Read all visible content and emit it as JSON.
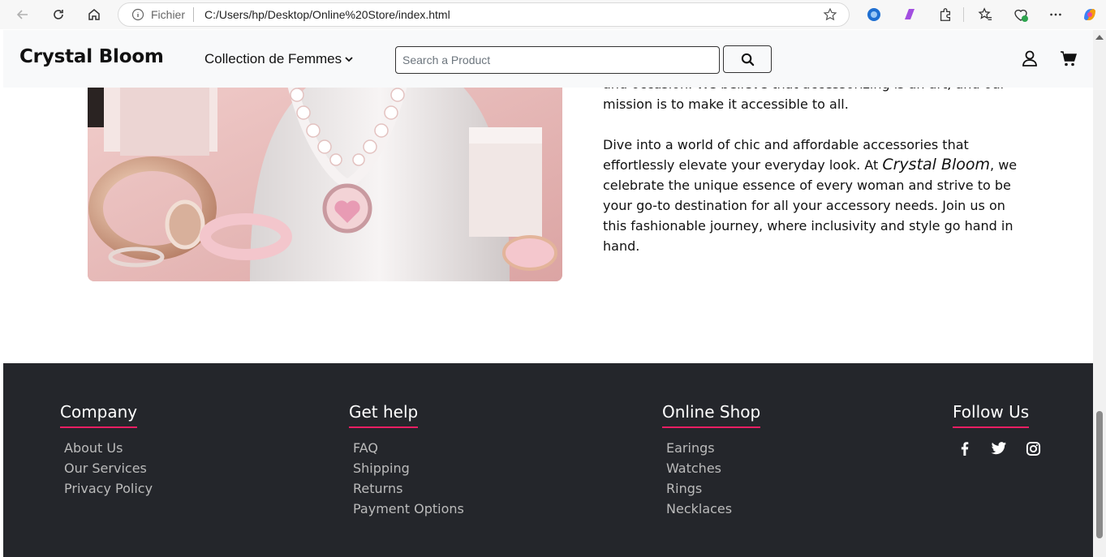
{
  "browser": {
    "scheme_label": "Fichier",
    "url": "C:/Users/hp/Desktop/Online%20Store/index.html"
  },
  "header": {
    "logo": "Crystal Bloom",
    "collection_label": "Collection de Femmes",
    "search_placeholder": "Search a Product"
  },
  "about": {
    "paragraph1_visible": "and occasion. We believe that accessorizing is an art, and our mission is to make it accessible to all.",
    "paragraph2_before": "Dive into a world of chic and affordable accessories that effortlessly elevate your everyday look. At ",
    "paragraph2_brand": "Crystal Bloom",
    "paragraph2_after": ", we celebrate the unique essence of every woman and strive to be your go-to destination for all your accessory needs. Join us on this fashionable journey, where inclusivity and style go hand in hand."
  },
  "footer": {
    "company": {
      "title": "Company",
      "links": [
        "About Us",
        "Our Services",
        "Privacy Policy"
      ]
    },
    "help": {
      "title": "Get help",
      "links": [
        "FAQ",
        "Shipping",
        "Returns",
        "Payment Options"
      ]
    },
    "shop": {
      "title": "Online Shop",
      "links": [
        "Earings",
        "Watches",
        "Rings",
        "Necklaces"
      ]
    },
    "follow": {
      "title": "Follow Us",
      "icons": [
        "facebook-icon",
        "twitter-icon",
        "instagram-icon"
      ]
    }
  },
  "colors": {
    "footer_bg": "#24262b",
    "accent": "#e91e63",
    "header_bg": "#f8f9fa"
  }
}
